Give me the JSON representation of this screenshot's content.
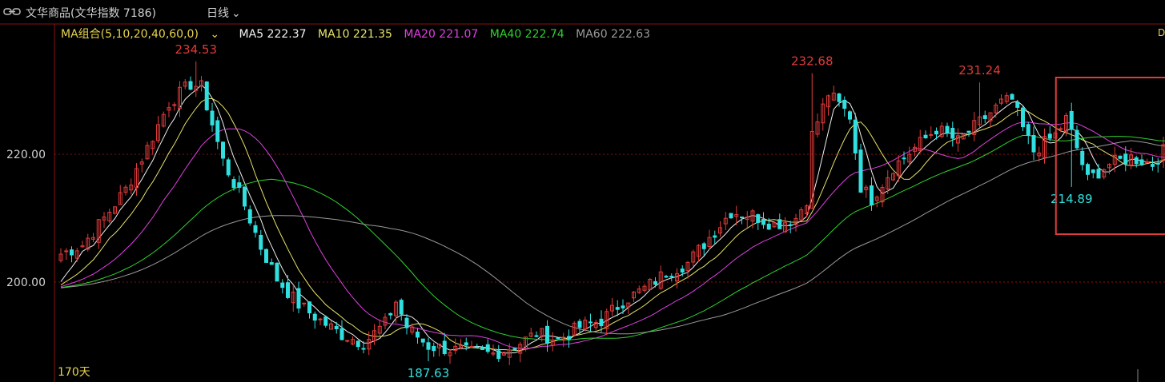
{
  "header": {
    "title": "文华商品(文华指数 7186)",
    "period": "日线",
    "edge_letter": "D"
  },
  "ma_bar": {
    "combo": "MA组合(5,10,20,40,60,0)",
    "items": [
      {
        "label": "MA5 222.37",
        "color": "#f0f0f0"
      },
      {
        "label": "MA10 221.35",
        "color": "#e8e36a"
      },
      {
        "label": "MA20 221.07",
        "color": "#e040e0"
      },
      {
        "label": "MA40 222.74",
        "color": "#2fd22f"
      },
      {
        "label": "MA60 222.63",
        "color": "#9a9a9a"
      }
    ]
  },
  "footer": {
    "days_label": "170天"
  },
  "colors": {
    "up": "#e03a3a",
    "down": "#30e0e0",
    "grid": "#8a1010",
    "axis": "#8a1010",
    "box": "#e03a3a"
  },
  "chart_data": {
    "type": "candlestick",
    "y_axis": {
      "ticks": [
        220.0,
        200.0
      ],
      "tick_labels": [
        "220.00",
        "200.00"
      ],
      "range": [
        186.4,
        237.8
      ]
    },
    "annotations": [
      {
        "label": "234.53",
        "value": 234.53,
        "kind": "high",
        "index": 25
      },
      {
        "label": "187.63",
        "value": 187.63,
        "kind": "low",
        "index": 68
      },
      {
        "label": "232.68",
        "value": 232.68,
        "kind": "high",
        "index": 139
      },
      {
        "label": "231.24",
        "value": 231.24,
        "kind": "high",
        "index": 170
      },
      {
        "label": "214.89",
        "value": 214.89,
        "kind": "low",
        "index": 187
      }
    ],
    "highlight_box": {
      "from_index": 185,
      "to_index": 207,
      "top_value": 232.0,
      "bottom_value": 207.5
    },
    "anchors": [
      [
        0,
        204.4
      ],
      [
        4,
        205.8
      ],
      [
        8,
        210.0
      ],
      [
        12,
        214.5
      ],
      [
        16,
        221.0
      ],
      [
        20,
        228.0
      ],
      [
        24,
        231.0
      ],
      [
        26,
        230.5
      ],
      [
        30,
        219.0
      ],
      [
        34,
        212.0
      ],
      [
        37,
        205.5
      ],
      [
        40,
        200.5
      ],
      [
        44,
        196.5
      ],
      [
        48,
        194.0
      ],
      [
        52,
        191.8
      ],
      [
        56,
        190.5
      ],
      [
        60,
        193.5
      ],
      [
        62,
        197.0
      ],
      [
        64,
        193.0
      ],
      [
        68,
        190.0
      ],
      [
        72,
        189.5
      ],
      [
        76,
        189.0
      ],
      [
        80,
        188.8
      ],
      [
        84,
        190.0
      ],
      [
        88,
        192.0
      ],
      [
        92,
        191.0
      ],
      [
        96,
        193.0
      ],
      [
        100,
        194.0
      ],
      [
        104,
        197.0
      ],
      [
        108,
        199.0
      ],
      [
        112,
        201.5
      ],
      [
        116,
        203.0
      ],
      [
        120,
        207.0
      ],
      [
        124,
        211.0
      ],
      [
        128,
        210.5
      ],
      [
        132,
        209.0
      ],
      [
        136,
        210.0
      ],
      [
        138,
        213.0
      ],
      [
        139,
        223.0
      ],
      [
        142,
        229.5
      ],
      [
        146,
        226.0
      ],
      [
        148,
        215.0
      ],
      [
        150,
        213.0
      ],
      [
        154,
        218.0
      ],
      [
        158,
        221.0
      ],
      [
        162,
        224.0
      ],
      [
        166,
        222.0
      ],
      [
        170,
        225.0
      ],
      [
        174,
        228.0
      ],
      [
        176,
        228.5
      ],
      [
        178,
        224.0
      ],
      [
        180,
        220.5
      ],
      [
        184,
        223.0
      ],
      [
        186,
        225.5
      ],
      [
        188,
        221.0
      ],
      [
        190,
        216.0
      ],
      [
        194,
        218.5
      ],
      [
        198,
        219.5
      ],
      [
        202,
        218.5
      ],
      [
        205,
        221.5
      ],
      [
        207,
        223.3
      ]
    ],
    "ma_series": [
      {
        "name": "MA5",
        "period": 5,
        "color": "#f0f0f0"
      },
      {
        "name": "MA10",
        "period": 10,
        "color": "#e8e36a"
      },
      {
        "name": "MA20",
        "period": 20,
        "color": "#e040e0"
      },
      {
        "name": "MA40",
        "period": 40,
        "color": "#2fd22f"
      },
      {
        "name": "MA60",
        "period": 60,
        "color": "#9a9a9a"
      }
    ]
  }
}
